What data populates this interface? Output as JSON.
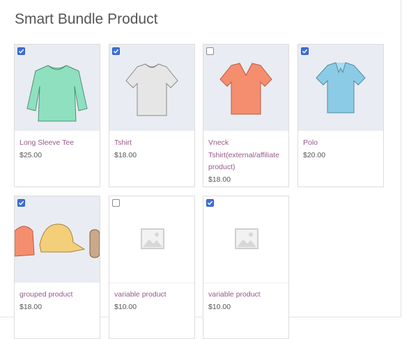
{
  "title": "Smart Bundle Product",
  "products": [
    {
      "name": "Long Sleeve Tee",
      "price": "$25.00",
      "checked": true,
      "image": "long-sleeve-tee"
    },
    {
      "name": "Tshirt",
      "price": "$18.00",
      "checked": true,
      "image": "tshirt"
    },
    {
      "name": "Vneck Tshirt(external/affiliate product)",
      "price": "$18.00",
      "checked": false,
      "image": "vneck-tshirt"
    },
    {
      "name": "Polo",
      "price": "$20.00",
      "checked": true,
      "image": "polo"
    },
    {
      "name": "grouped product",
      "price": "$18.00",
      "checked": true,
      "image": "grouped-hats-belt"
    },
    {
      "name": "variable product",
      "price": "$10.00",
      "checked": false,
      "image": "placeholder"
    },
    {
      "name": "variable product",
      "price": "$10.00",
      "checked": true,
      "image": "placeholder"
    }
  ],
  "colors": {
    "accent": "#3e6fd8",
    "link": "#96588a",
    "image_bg": "#e9ecf2",
    "long_sleeve": "#8fe0bf",
    "tshirt": "#e6e6e6",
    "vneck": "#f58d6f",
    "polo": "#8ccbe6",
    "cap": "#f3cf7a"
  }
}
